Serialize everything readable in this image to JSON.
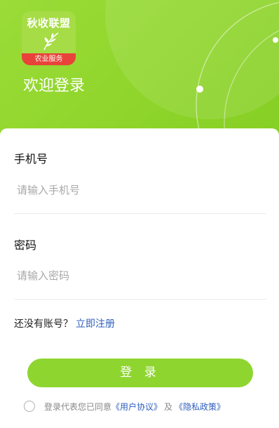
{
  "header": {
    "logo": {
      "title": "秋收联盟",
      "ribbon": "农业服务"
    },
    "welcome": "欢迎登录"
  },
  "form": {
    "phone": {
      "label": "手机号",
      "placeholder": "请输入手机号"
    },
    "password": {
      "label": "密码",
      "placeholder": "请输入密码"
    },
    "register": {
      "prompt": "还没有账号？",
      "link": "立即注册"
    },
    "login_button": "登 录"
  },
  "agreement": {
    "prefix": "登录代表您已同意",
    "user_agreement": "《用户协议》",
    "and": "及",
    "privacy_policy": "《隐私政策》"
  },
  "colors": {
    "brand_green": "#8fd530",
    "link_blue": "#2f5ebd",
    "logo_ribbon": "#e8433a"
  }
}
